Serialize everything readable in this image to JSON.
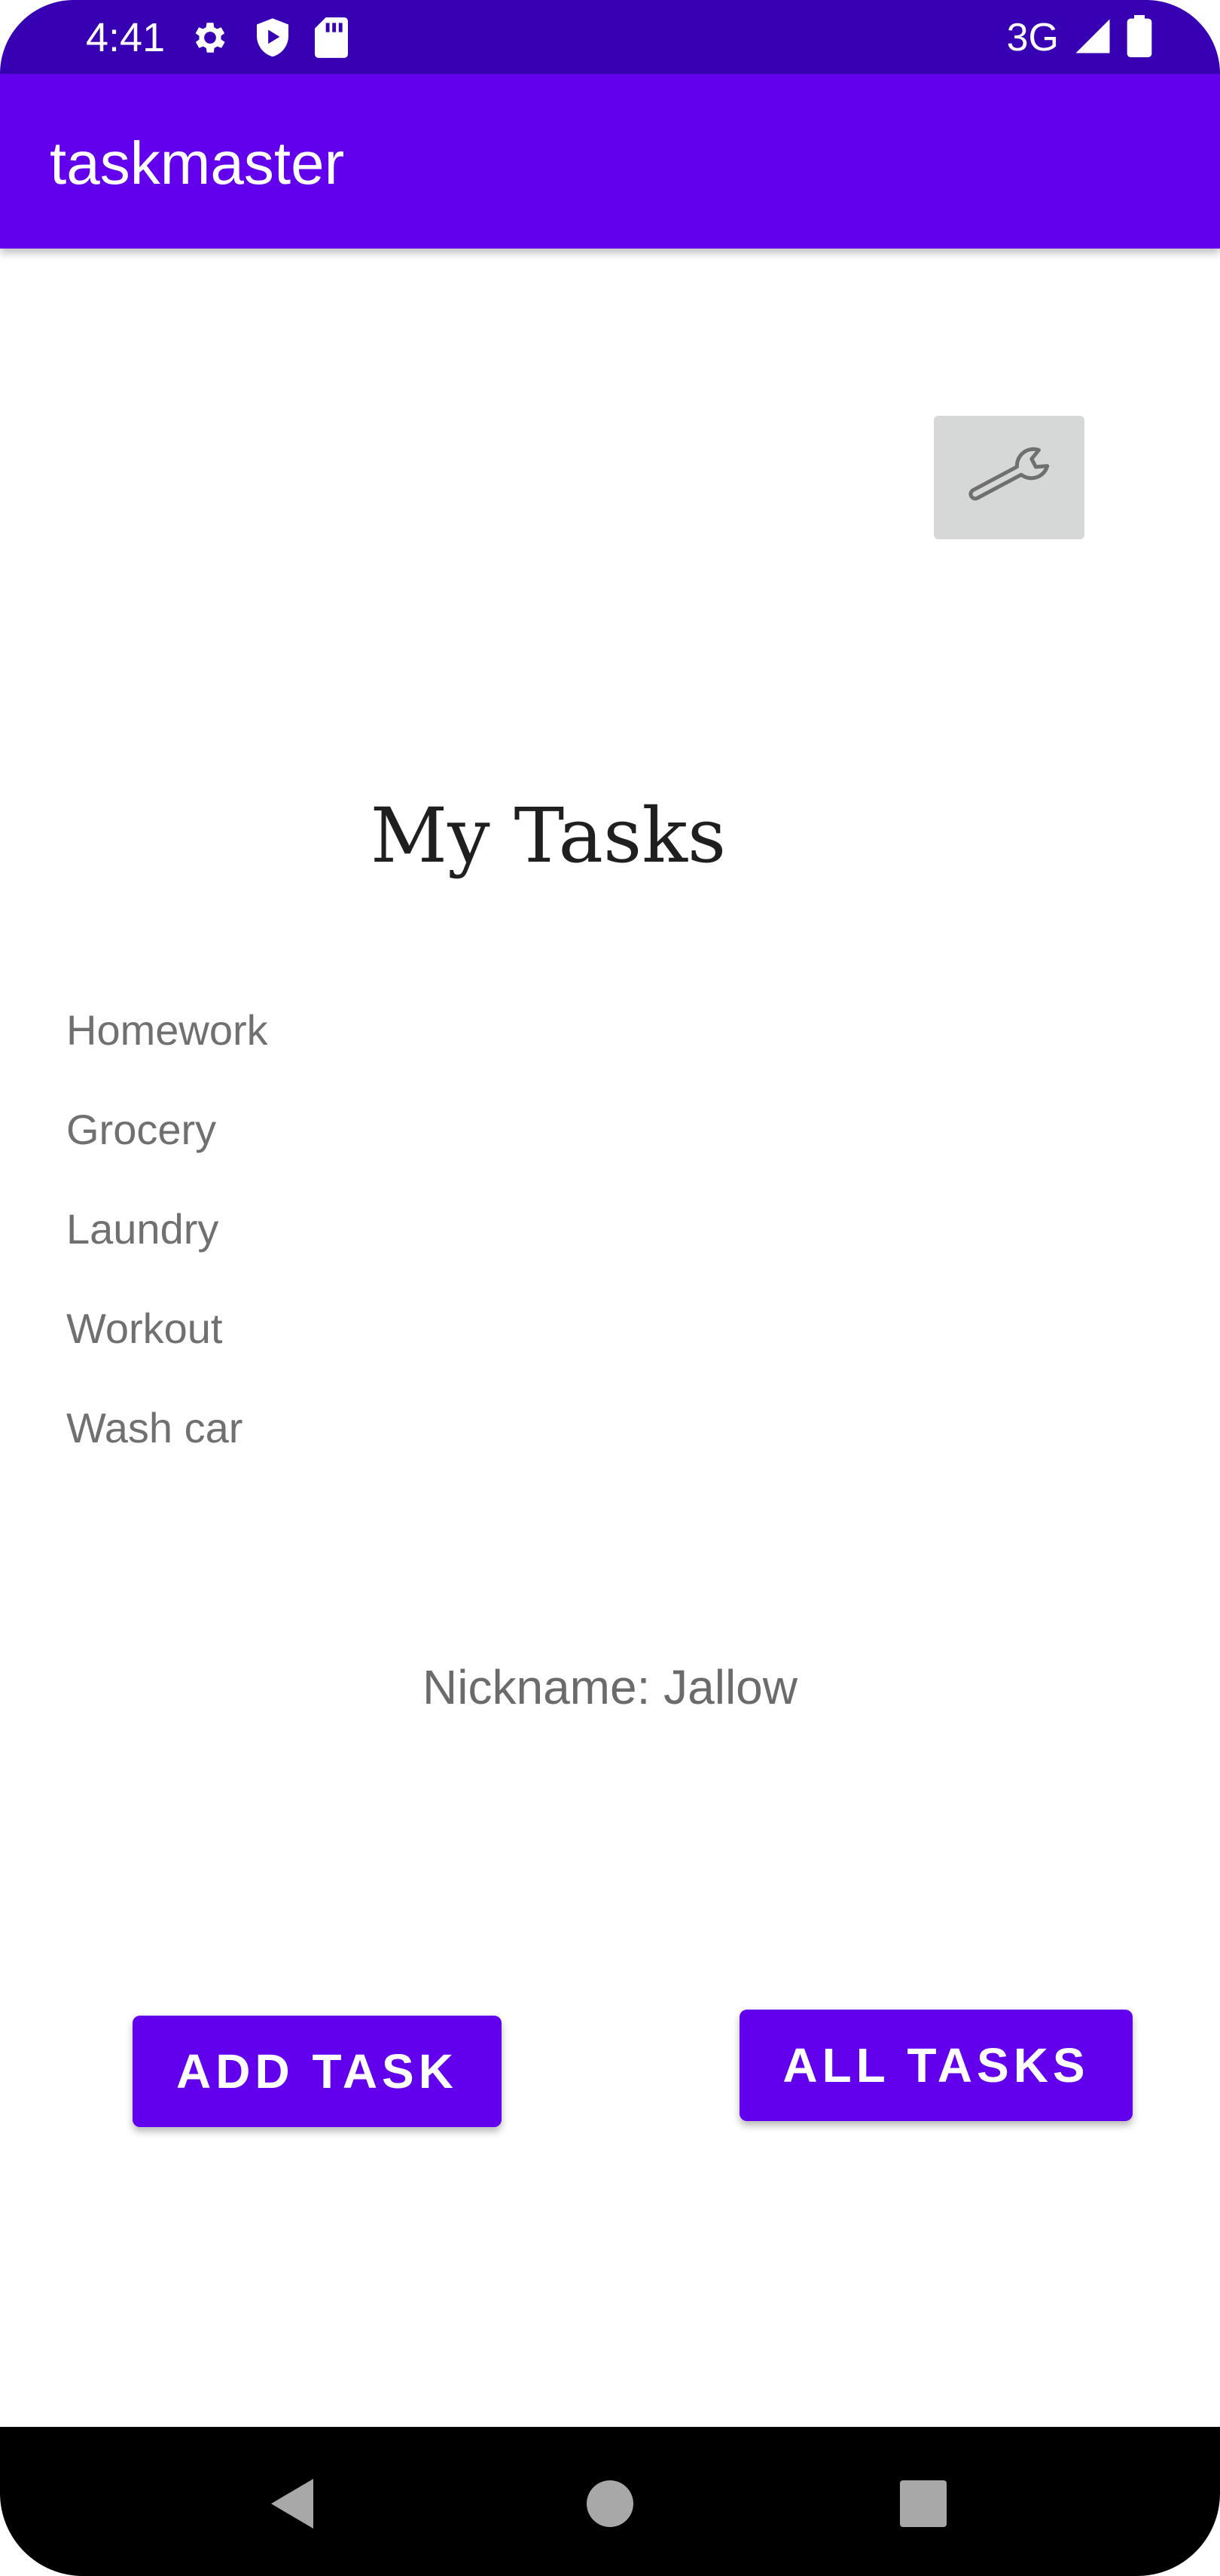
{
  "status_bar": {
    "time": "4:41",
    "network": "3G",
    "icons": [
      "gear-icon",
      "shield-play-icon",
      "sd-card-icon",
      "signal-icon",
      "battery-icon"
    ]
  },
  "app_bar": {
    "title": "taskmaster"
  },
  "settings": {
    "icon": "wrench-icon"
  },
  "main": {
    "title": "My Tasks",
    "tasks": [
      {
        "label": "Homework"
      },
      {
        "label": "Grocery"
      },
      {
        "label": "Laundry"
      },
      {
        "label": "Workout"
      },
      {
        "label": "Wash car"
      }
    ],
    "nickname": "Nickname: Jallow"
  },
  "buttons": {
    "add_task": "ADD TASK",
    "all_tasks": "ALL TASKS"
  },
  "nav_bar": {
    "icons": [
      "back-icon",
      "home-icon",
      "recents-icon"
    ]
  },
  "colors": {
    "status_bar": "#3700b3",
    "primary": "#6200ee",
    "button_text": "#ffffff",
    "task_text": "#707070",
    "settings_button": "#d6d7d7"
  }
}
